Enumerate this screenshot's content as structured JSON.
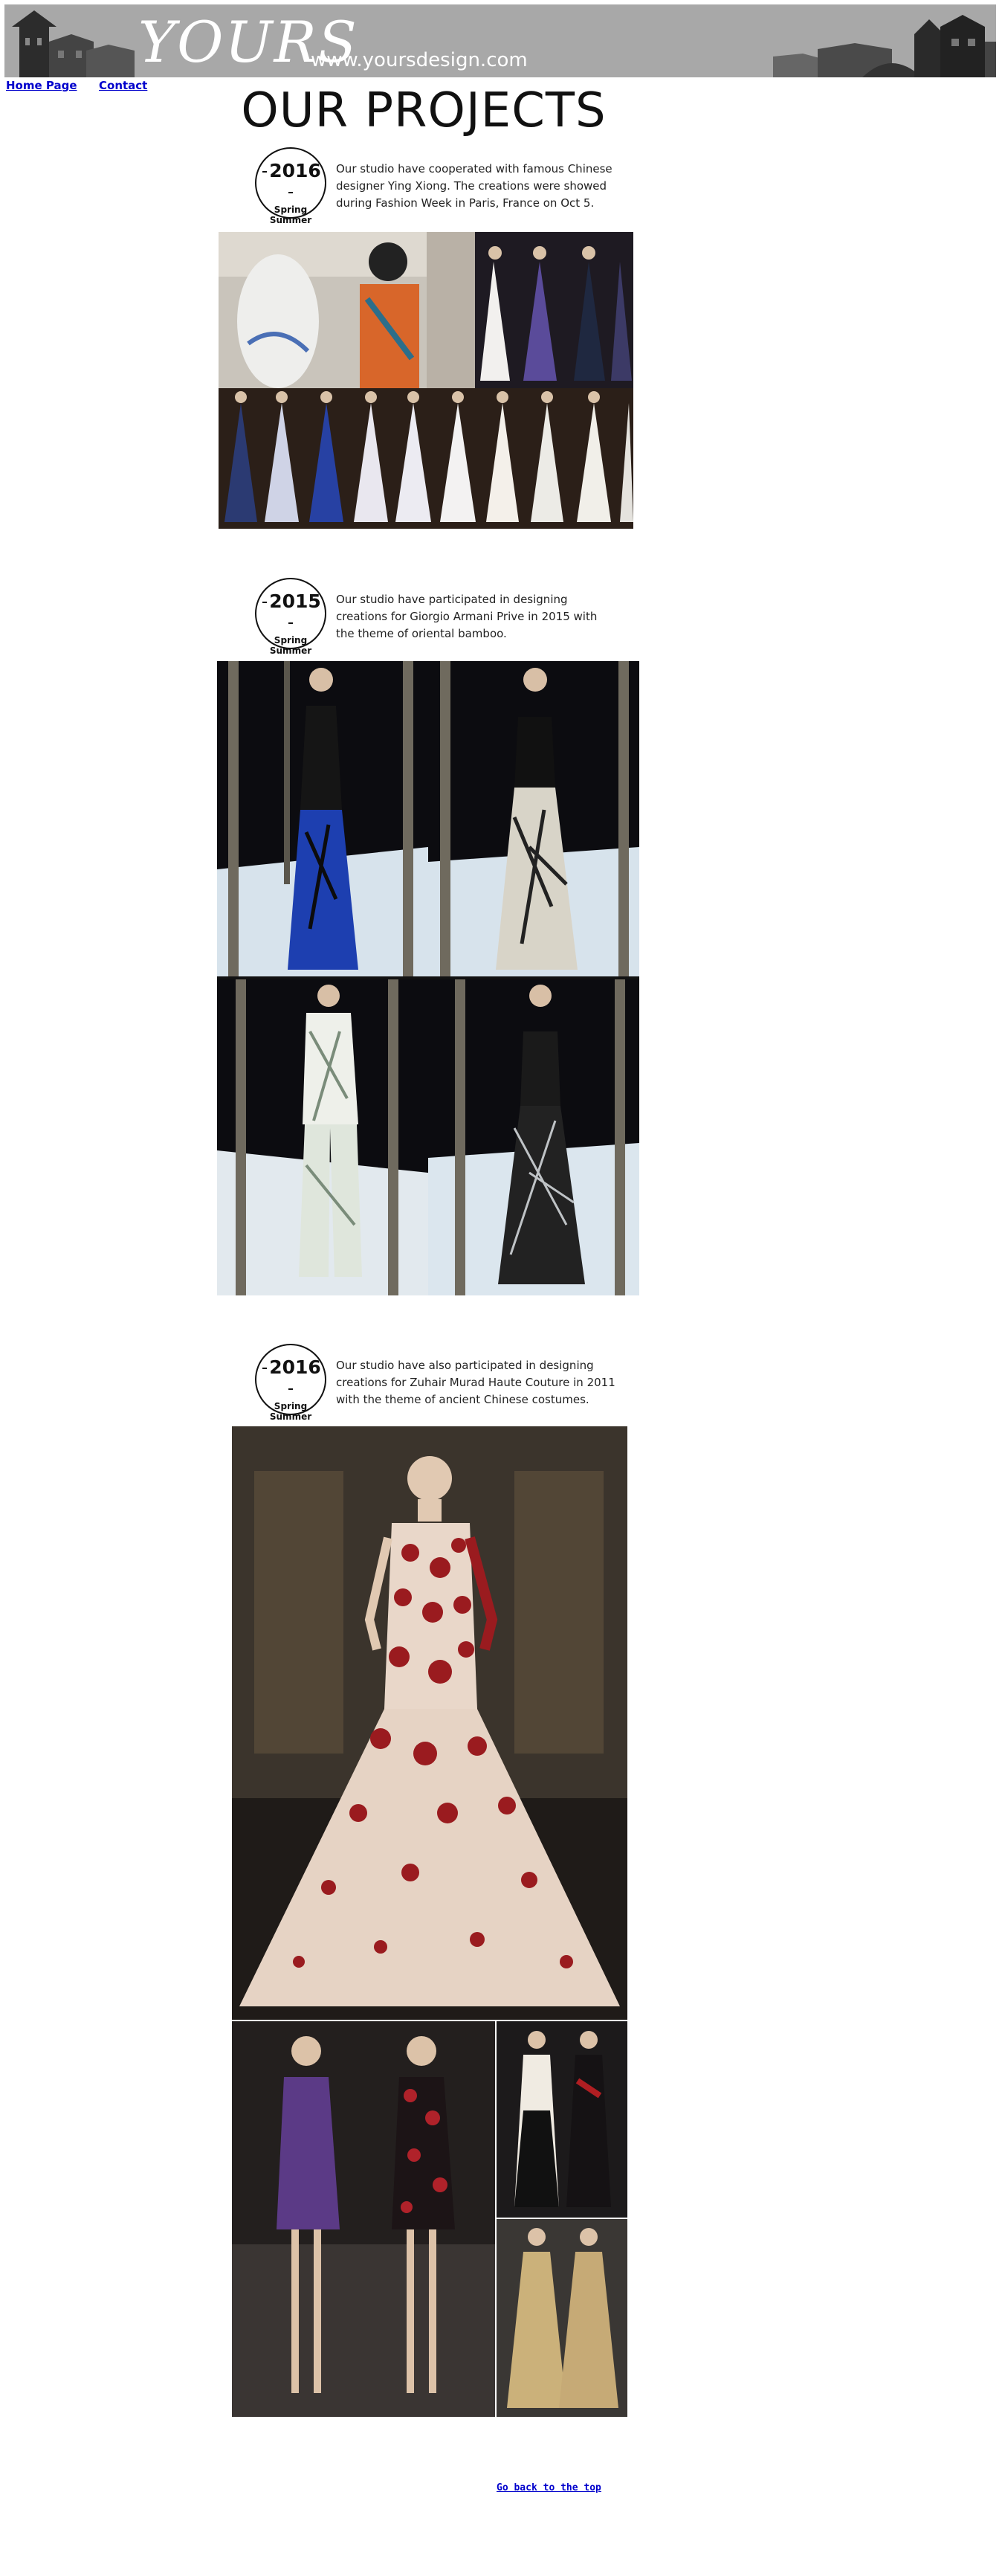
{
  "header": {
    "logo": "YOURS",
    "url": "www.yoursdesign.com"
  },
  "nav": {
    "home": "Home Page",
    "contact": "Contact"
  },
  "page_title": "OUR PROJECTS",
  "projects": [
    {
      "year": "2016",
      "season_line1": "Spring",
      "season_line2": "Summer",
      "description": "Our studio have cooperated with famous Chinese designer Ying Xiong. The creations were showed during Fashion Week in Paris, France on Oct 5."
    },
    {
      "year": "2015",
      "season_line1": "Spring",
      "season_line2": "Summer",
      "description": "Our studio have participated in designing creations for Giorgio Armani Prive in 2015 with the theme of oriental bamboo."
    },
    {
      "year": "2016",
      "season_line1": "Spring",
      "season_line2": "Summer",
      "description": "Our studio have also participated in designing creations for Zuhair Murad Haute Couture in 2011 with the theme of ancient Chinese costumes."
    }
  ],
  "back_to_top": "Go back to the top",
  "colors": {
    "banner": "#a8a8a8",
    "link": "#0000cc"
  }
}
